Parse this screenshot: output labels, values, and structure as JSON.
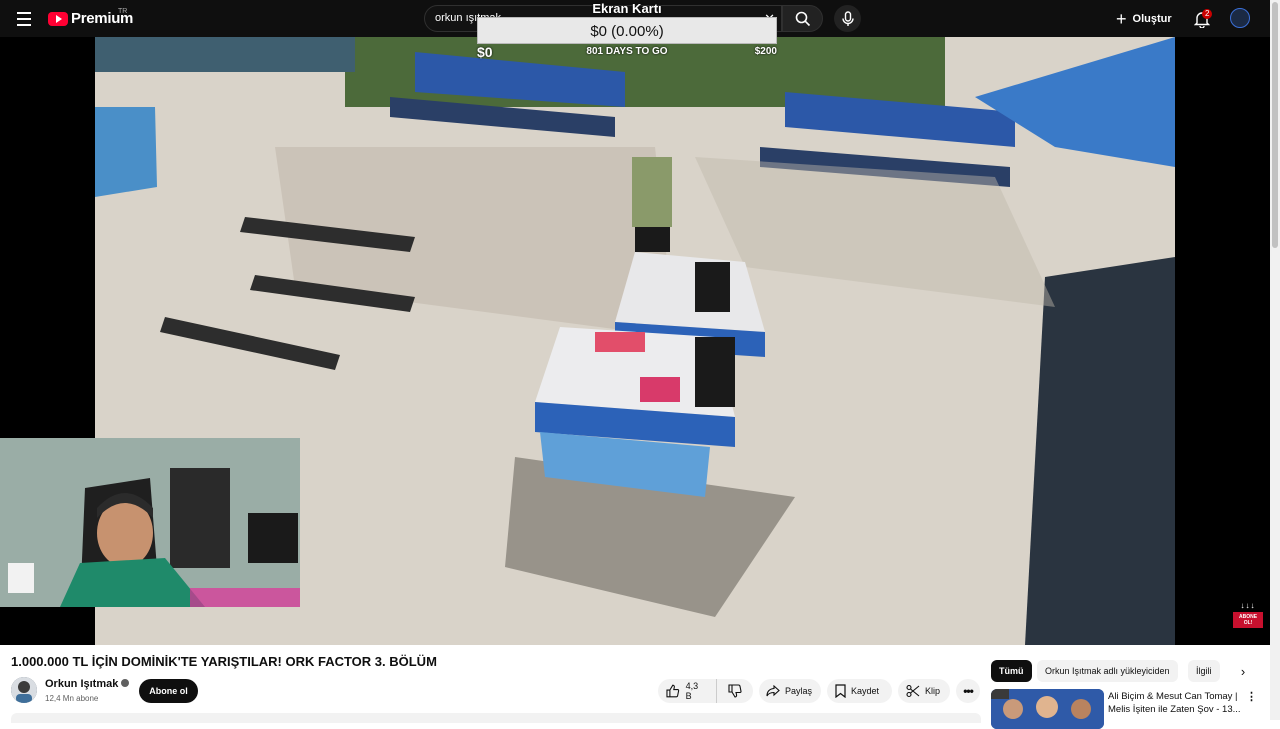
{
  "masthead": {
    "logo_text": "Premium",
    "country_code": "TR",
    "search_value": "orkun ışıtmak",
    "create_label": "Oluştur",
    "notification_count": "2",
    "icons": [
      "menu-icon",
      "search-icon",
      "mic-icon",
      "plus-icon",
      "bell-icon",
      "close-icon"
    ]
  },
  "widget": {
    "title": "Ekran Kartı",
    "amount": "$0 (0.00%)",
    "progress_fraction": 0.0,
    "left_value": "$0",
    "days_label": "801 DAYS TO GO",
    "right_value": "$200"
  },
  "video": {
    "title": "1.000.000 TL İÇİN DOMİNİK'TE YARIŞTILAR! ORK FACTOR 3. BÖLÜM",
    "channel_name": "Orkun Işıtmak",
    "subscribers": "12,4 Mn abone",
    "subscribe_label": "Abone ol",
    "likes": "4,3 B",
    "share_label": "Paylaş",
    "save_label": "Kaydet",
    "clip_label": "Klip",
    "overlay_subscribe": "ABONE OL!"
  },
  "sidebar": {
    "chips": [
      "Tümü",
      "Orkun Işıtmak adlı yükleyiciden",
      "İlgili"
    ],
    "recommendation": {
      "title": "Ali Biçim & Mesut Can Tomay | Melis İşiten ile Zaten Şov - 13..."
    }
  },
  "colors": {
    "brand_red": "#ff0033",
    "masthead_bg": "#0f0f0f",
    "subscribe_bg": "#0f0f0f"
  }
}
